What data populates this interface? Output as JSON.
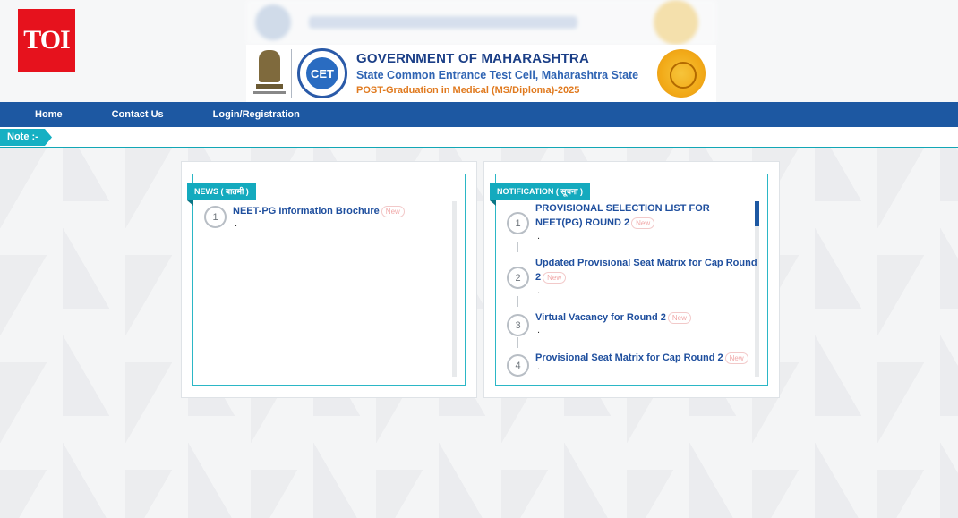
{
  "brand": {
    "toi": "TOI"
  },
  "header": {
    "title": "GOVERNMENT OF MAHARASHTRA",
    "subtitle": "State Common Entrance Test Cell, Maharashtra State",
    "course": "POST-Graduation in Medical (MS/Diploma)-2025",
    "cet_label": "CET"
  },
  "nav": {
    "items": [
      {
        "label": "Home"
      },
      {
        "label": "Contact Us"
      },
      {
        "label": "Login/Registration"
      }
    ]
  },
  "note": {
    "label": "Note :-"
  },
  "news": {
    "title": "NEWS ( बातमी )",
    "items": [
      {
        "num": "1",
        "text": "NEET-PG Information Brochure",
        "badge": "New",
        "dot": "."
      }
    ]
  },
  "notification": {
    "title": "NOTIFICATION ( सूचना )",
    "items": [
      {
        "num": "1",
        "text": "PROVISIONAL SELECTION LIST FOR NEET(PG) ROUND 2",
        "badge": "New",
        "dot": "."
      },
      {
        "num": "2",
        "text": "Updated Provisional Seat Matrix for Cap Round 2",
        "badge": "New",
        "dot": "."
      },
      {
        "num": "3",
        "text": "Virtual Vacancy for Round 2",
        "badge": "New",
        "dot": "."
      },
      {
        "num": "4",
        "text": "Provisional Seat Matrix for Cap Round 2",
        "badge": "New",
        "dot": "."
      }
    ]
  },
  "colors": {
    "nav_bg": "#1d58a2",
    "accent_teal": "#14aabe",
    "link_blue": "#1f4f9e",
    "toi_red": "#e6121d"
  }
}
